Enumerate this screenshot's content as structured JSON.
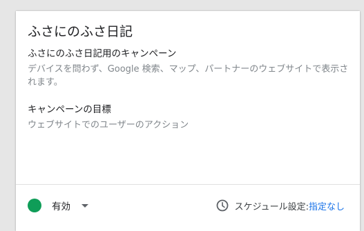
{
  "card": {
    "title": "ふさにのふさ日記",
    "campaign": {
      "heading": "ふさにのふさ日記用のキャンペーン",
      "description": "デバイスを問わず、Google 検索、マップ、パートナーのウェブサイトで表示されます。"
    },
    "goal": {
      "heading": "キャンペーンの目標",
      "description": "ウェブサイトでのユーザーのアクション"
    }
  },
  "footer": {
    "status": {
      "label": "有効",
      "color": "#0f9d58"
    },
    "schedule": {
      "icon": "clock-icon",
      "label": "スケジュール設定: ",
      "value": "指定なし",
      "value_color": "#1a73e8"
    }
  }
}
